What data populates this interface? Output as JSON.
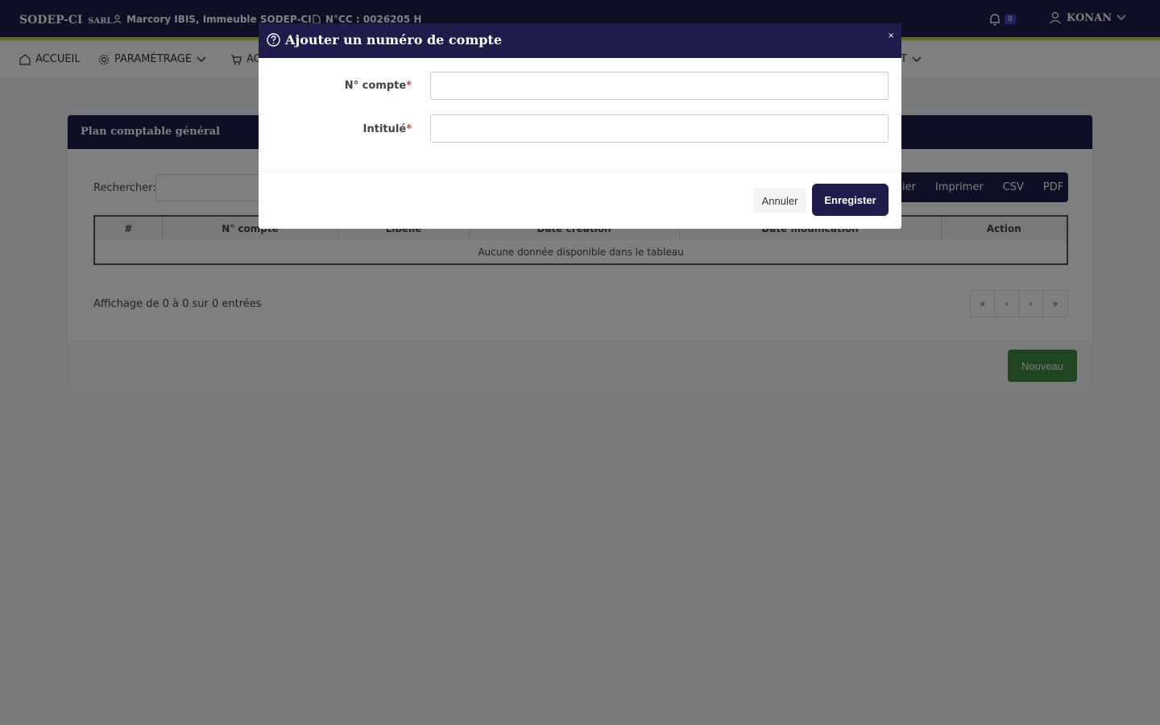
{
  "header": {
    "brand": "SODEP-CI",
    "brand_suffix": "SARL",
    "address": "Marcory IBIS, Immeuble SODEP-CI",
    "ncc": "N°CC : 0026205 H",
    "notification_count": "0",
    "user_name": "KONAN"
  },
  "nav": {
    "items": [
      {
        "label": "ACCUEIL"
      },
      {
        "label": "PARAMÉTRAGE"
      },
      {
        "label": "AC"
      },
      {
        "label": "T"
      }
    ]
  },
  "card": {
    "title": "Plan comptable général",
    "search_label": "Rechercher:",
    "export_buttons": [
      "ier",
      "Imprimer",
      "CSV",
      "PDF"
    ],
    "table_headers": [
      "#",
      "N° compte",
      "Libellé",
      "Date création",
      "Date modification",
      "Action"
    ],
    "empty_message": "Aucune donnée disponible dans le tableau",
    "info": "Affichage de 0 à 0 sur 0 entrées",
    "pager": [
      "«",
      "‹",
      "›",
      "»"
    ],
    "new_button": "Nouveau"
  },
  "modal": {
    "title": "Ajouter un numéro de compte",
    "close": "×",
    "fields": [
      {
        "label": "N° compte",
        "required": "*",
        "value": ""
      },
      {
        "label": "Intitulé",
        "required": "*",
        "value": ""
      }
    ],
    "cancel_label": "Annuler",
    "save_label": "Enregister"
  }
}
